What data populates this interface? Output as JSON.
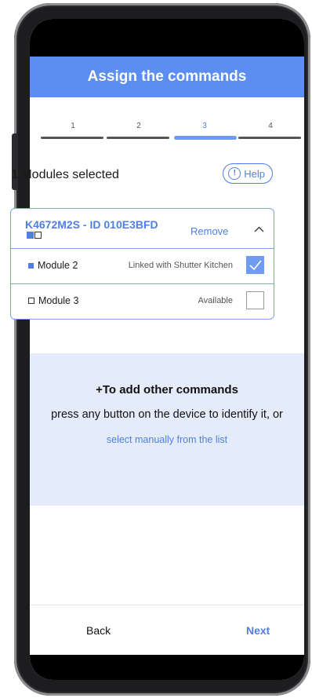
{
  "header": {
    "title": "Assign the commands"
  },
  "stepper": {
    "steps": [
      "1",
      "2",
      "3",
      "4"
    ],
    "active_step": "3"
  },
  "selection": {
    "count": "1",
    "label": " Modules selected"
  },
  "help": {
    "label": "Help",
    "icon": "question-circle-icon"
  },
  "device": {
    "name": "K4672M2S - ID 010E3BFD",
    "remove_label": "Remove",
    "expanded": true,
    "modules": [
      {
        "label": "Module 2",
        "status": "Linked with Shutter Kitchen",
        "checked": true
      },
      {
        "label": "Module 3",
        "status": "Available",
        "checked": false
      }
    ]
  },
  "add_commands": {
    "title": "+To add other commands",
    "description": "press any button on the device to identify it, or",
    "link": "select manually from the list"
  },
  "footer": {
    "back_label": "Back",
    "next_label": "Next"
  },
  "colors": {
    "accent": "#5b8ef0",
    "link": "#4f7fe6",
    "panel": "#e4ecfb"
  }
}
